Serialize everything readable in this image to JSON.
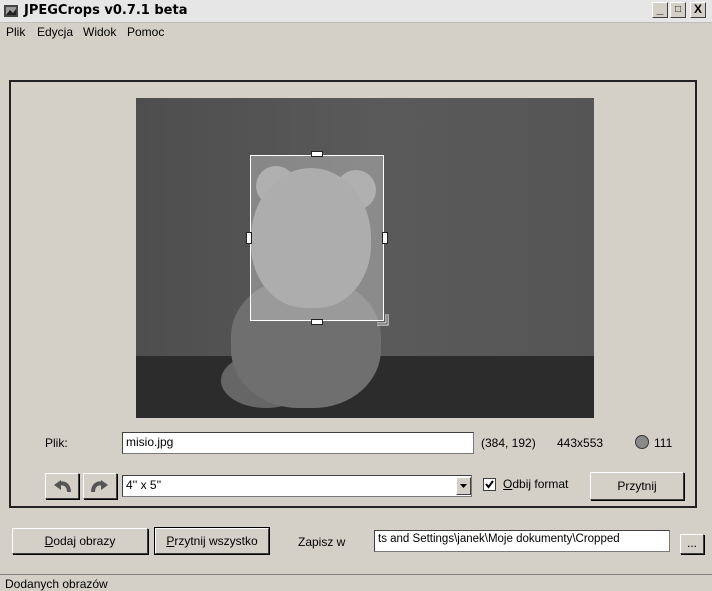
{
  "window": {
    "title": "JPEGCrops v0.7.1 beta",
    "minimize": "_",
    "maximize": "□",
    "close": "X"
  },
  "menu": [
    "Plik",
    "Edycja",
    "Widok",
    "Pomoc"
  ],
  "crop": {
    "file_label": "Plik:",
    "file_value": "misio.jpg",
    "coords": "(384, 192)",
    "size": "443x553",
    "quality_value": "111",
    "format_value": "4'' x 5''",
    "mirror_mnemonic": "O",
    "mirror_rest": "dbij format",
    "mirror_checked": true,
    "crop_button": "Przytnij"
  },
  "bottom": {
    "add_mnemonic": "D",
    "add_rest": "odaj obrazy",
    "cropall_mnemonic": "P",
    "cropall_rest": "rzytnij wszystko",
    "save_label": "Zapisz w",
    "save_path": "ts and Settings\\janek\\Moje dokumenty\\Cropped",
    "browse": "..."
  },
  "status": "Dodanych obrazów"
}
